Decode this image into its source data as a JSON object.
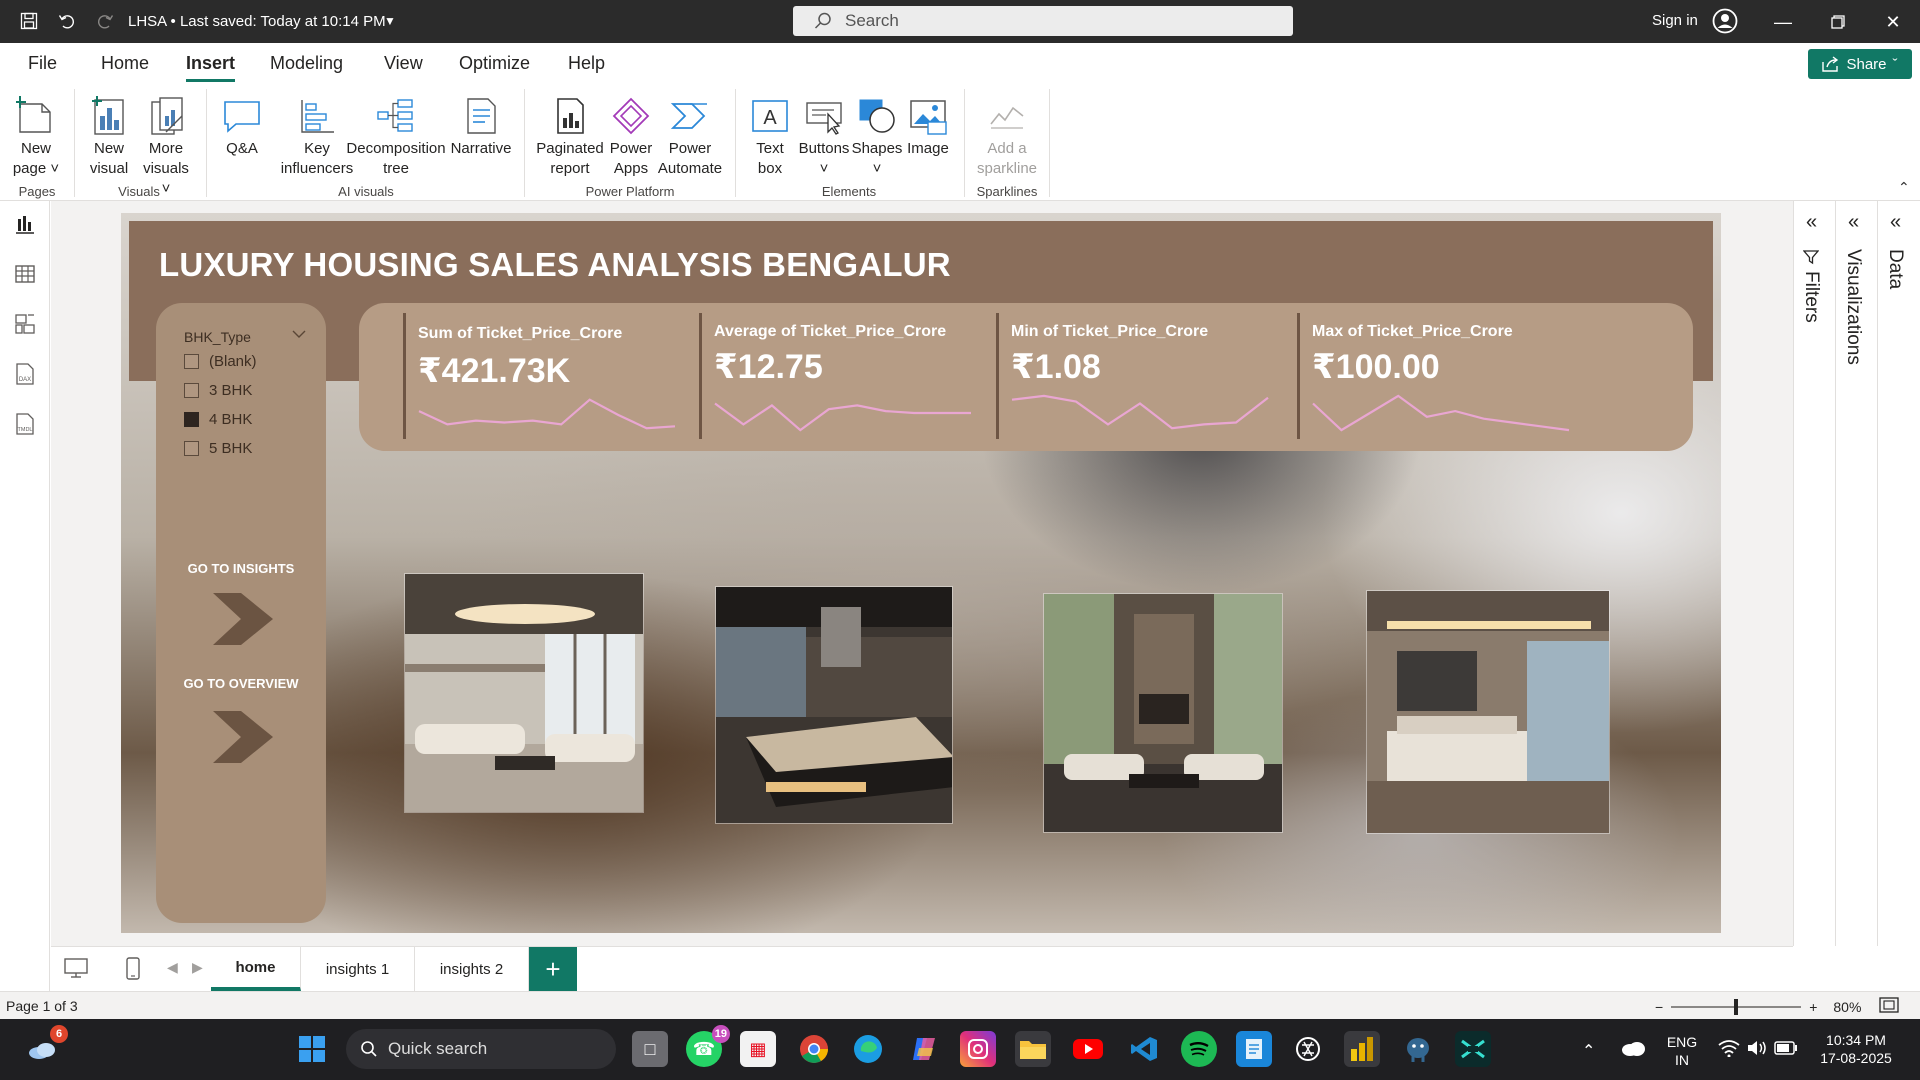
{
  "window": {
    "doc_title": "LHSA • Last saved: Today at 10:14 PM",
    "search_placeholder": "Search",
    "signin_label": "Sign in"
  },
  "menu": {
    "items": [
      "File",
      "Home",
      "Insert",
      "Modeling",
      "View",
      "Optimize",
      "Help"
    ],
    "active": "Insert",
    "share_label": "Share"
  },
  "ribbon": {
    "buttons": {
      "new_page": [
        "New",
        "page ˅"
      ],
      "new_visual": [
        "New",
        "visual"
      ],
      "more_visuals": [
        "More",
        "visuals ˅"
      ],
      "qna": [
        "Q&A"
      ],
      "key_influencers": [
        "Key",
        "influencers"
      ],
      "decomposition_tree": [
        "Decomposition",
        "tree"
      ],
      "narrative": [
        "Narrative"
      ],
      "paginated_report": [
        "Paginated",
        "report"
      ],
      "power_apps": [
        "Power",
        "Apps"
      ],
      "power_automate": [
        "Power",
        "Automate"
      ],
      "text_box": [
        "Text",
        "box"
      ],
      "buttons": [
        "Buttons",
        "˅"
      ],
      "shapes": [
        "Shapes",
        "˅"
      ],
      "image": [
        "Image"
      ],
      "add_sparkline": [
        "Add a",
        "sparkline"
      ]
    },
    "groups": {
      "pages": "Pages",
      "visuals": "Visuals",
      "ai_visuals": "AI visuals",
      "power_platform": "Power Platform",
      "elements": "Elements",
      "sparklines": "Sparklines"
    }
  },
  "report": {
    "title": "LUXURY HOUSING SALES ANALYSIS BENGALUR",
    "slicer": {
      "title": "BHK_Type",
      "items": [
        {
          "label": "(Blank)",
          "checked": false
        },
        {
          "label": "3 BHK",
          "checked": false
        },
        {
          "label": "4 BHK",
          "checked": true
        },
        {
          "label": "5 BHK",
          "checked": false
        }
      ]
    },
    "nav": {
      "insights": "GO TO INSIGHTS",
      "overview": "GO TO OVERVIEW"
    },
    "kpis": [
      {
        "label": "Sum of Ticket_Price_Crore",
        "value": "₹421.73K",
        "spark": [
          0.55,
          0.2,
          0.3,
          0.25,
          0.3,
          0.2,
          0.85,
          0.45,
          0.1,
          0.15
        ]
      },
      {
        "label": "Average of Ticket_Price_Crore",
        "value": "₹12.75",
        "spark": [
          0.75,
          0.2,
          0.7,
          0.05,
          0.6,
          0.7,
          0.55,
          0.5,
          0.5,
          0.5
        ]
      },
      {
        "label": "Min of Ticket_Price_Crore",
        "value": "₹1.08",
        "spark": [
          0.85,
          0.95,
          0.8,
          0.2,
          0.75,
          0.1,
          0.2,
          0.25,
          0.9
        ]
      },
      {
        "label": "Max of Ticket_Price_Crore",
        "value": "₹100.00",
        "spark": [
          0.75,
          0.05,
          0.5,
          0.95,
          0.4,
          0.55,
          0.35,
          0.25,
          0.15,
          0.05
        ]
      }
    ]
  },
  "panes": {
    "filters": "Filters",
    "visualizations": "Visualizations",
    "data": "Data"
  },
  "tabs": [
    "home",
    "insights 1",
    "insights 2"
  ],
  "active_tab": "home",
  "status": {
    "page_count": "Page 1 of 3",
    "zoom": "80%",
    "zoom_level": 0.8
  },
  "taskbar": {
    "search_label": "Quick search",
    "weather_badge": "6",
    "whatsapp_badge": "19",
    "lang_top": "ENG",
    "lang_bottom": "IN",
    "time": "10:34 PM",
    "date": "17-08-2025"
  },
  "colors": {
    "accent": "#117865",
    "header_band": "#8a6e5b",
    "kpi_panel": "#b69c85",
    "slicer_panel": "#a88f78",
    "sparkline": "#e9a6d2"
  }
}
